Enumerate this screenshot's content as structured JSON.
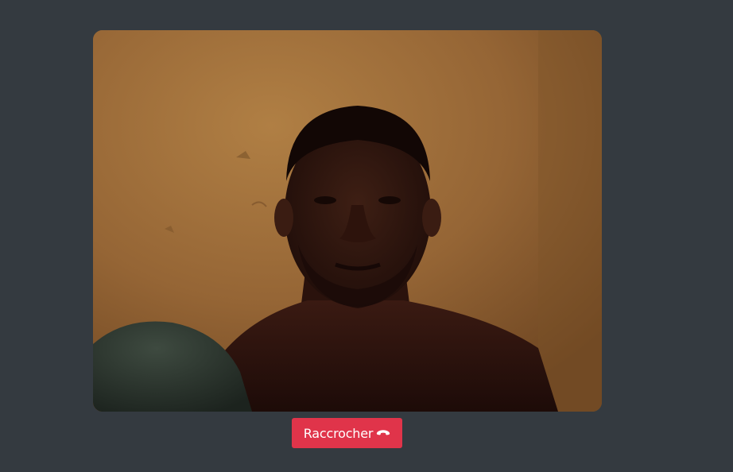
{
  "call": {
    "hangup_label": "Raccrocher",
    "hangup_icon": "phone-hangup-icon"
  },
  "colors": {
    "page_background": "#343a40",
    "hangup_button": "#e0344a",
    "hangup_text": "#ffffff"
  }
}
